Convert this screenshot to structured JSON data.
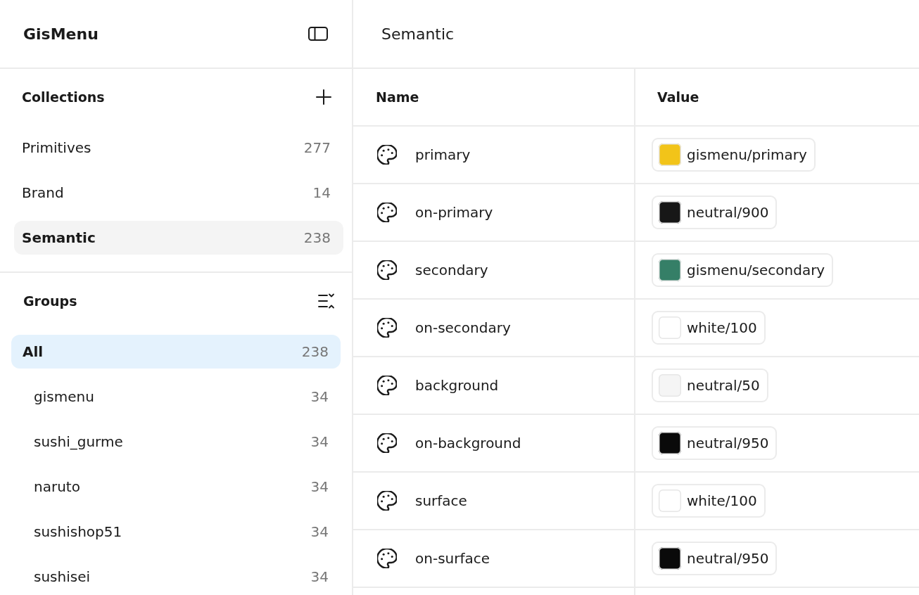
{
  "sidebar": {
    "title": "GisMenu",
    "collections": {
      "heading": "Collections",
      "items": [
        {
          "label": "Primitives",
          "count": "277",
          "selected": false
        },
        {
          "label": "Brand",
          "count": "14",
          "selected": false
        },
        {
          "label": "Semantic",
          "count": "238",
          "selected": true
        }
      ]
    },
    "groups": {
      "heading": "Groups",
      "items": [
        {
          "label": "All",
          "count": "238",
          "selected": true,
          "children": [
            {
              "label": "gismenu",
              "count": "34",
              "selected": false
            },
            {
              "label": "sushi_gurme",
              "count": "34",
              "selected": false
            },
            {
              "label": "naruto",
              "count": "34",
              "selected": false
            },
            {
              "label": "sushishop51",
              "count": "34",
              "selected": false
            },
            {
              "label": "sushisei",
              "count": "34",
              "selected": false
            }
          ]
        }
      ]
    }
  },
  "main": {
    "title": "Semantic",
    "table": {
      "columns": [
        "Name",
        "Value"
      ],
      "rows": [
        {
          "name": "primary",
          "value": "gismenu/primary",
          "color": "#f2c419"
        },
        {
          "name": "on-primary",
          "value": "neutral/900",
          "color": "#171717"
        },
        {
          "name": "secondary",
          "value": "gismenu/secondary",
          "color": "#357f67"
        },
        {
          "name": "on-secondary",
          "value": "white/100",
          "color": "#ffffff"
        },
        {
          "name": "background",
          "value": "neutral/50",
          "color": "#f5f5f5"
        },
        {
          "name": "on-background",
          "value": "neutral/950",
          "color": "#0a0a0a"
        },
        {
          "name": "surface",
          "value": "white/100",
          "color": "#ffffff"
        },
        {
          "name": "on-surface",
          "value": "neutral/950",
          "color": "#0a0a0a"
        }
      ]
    }
  }
}
